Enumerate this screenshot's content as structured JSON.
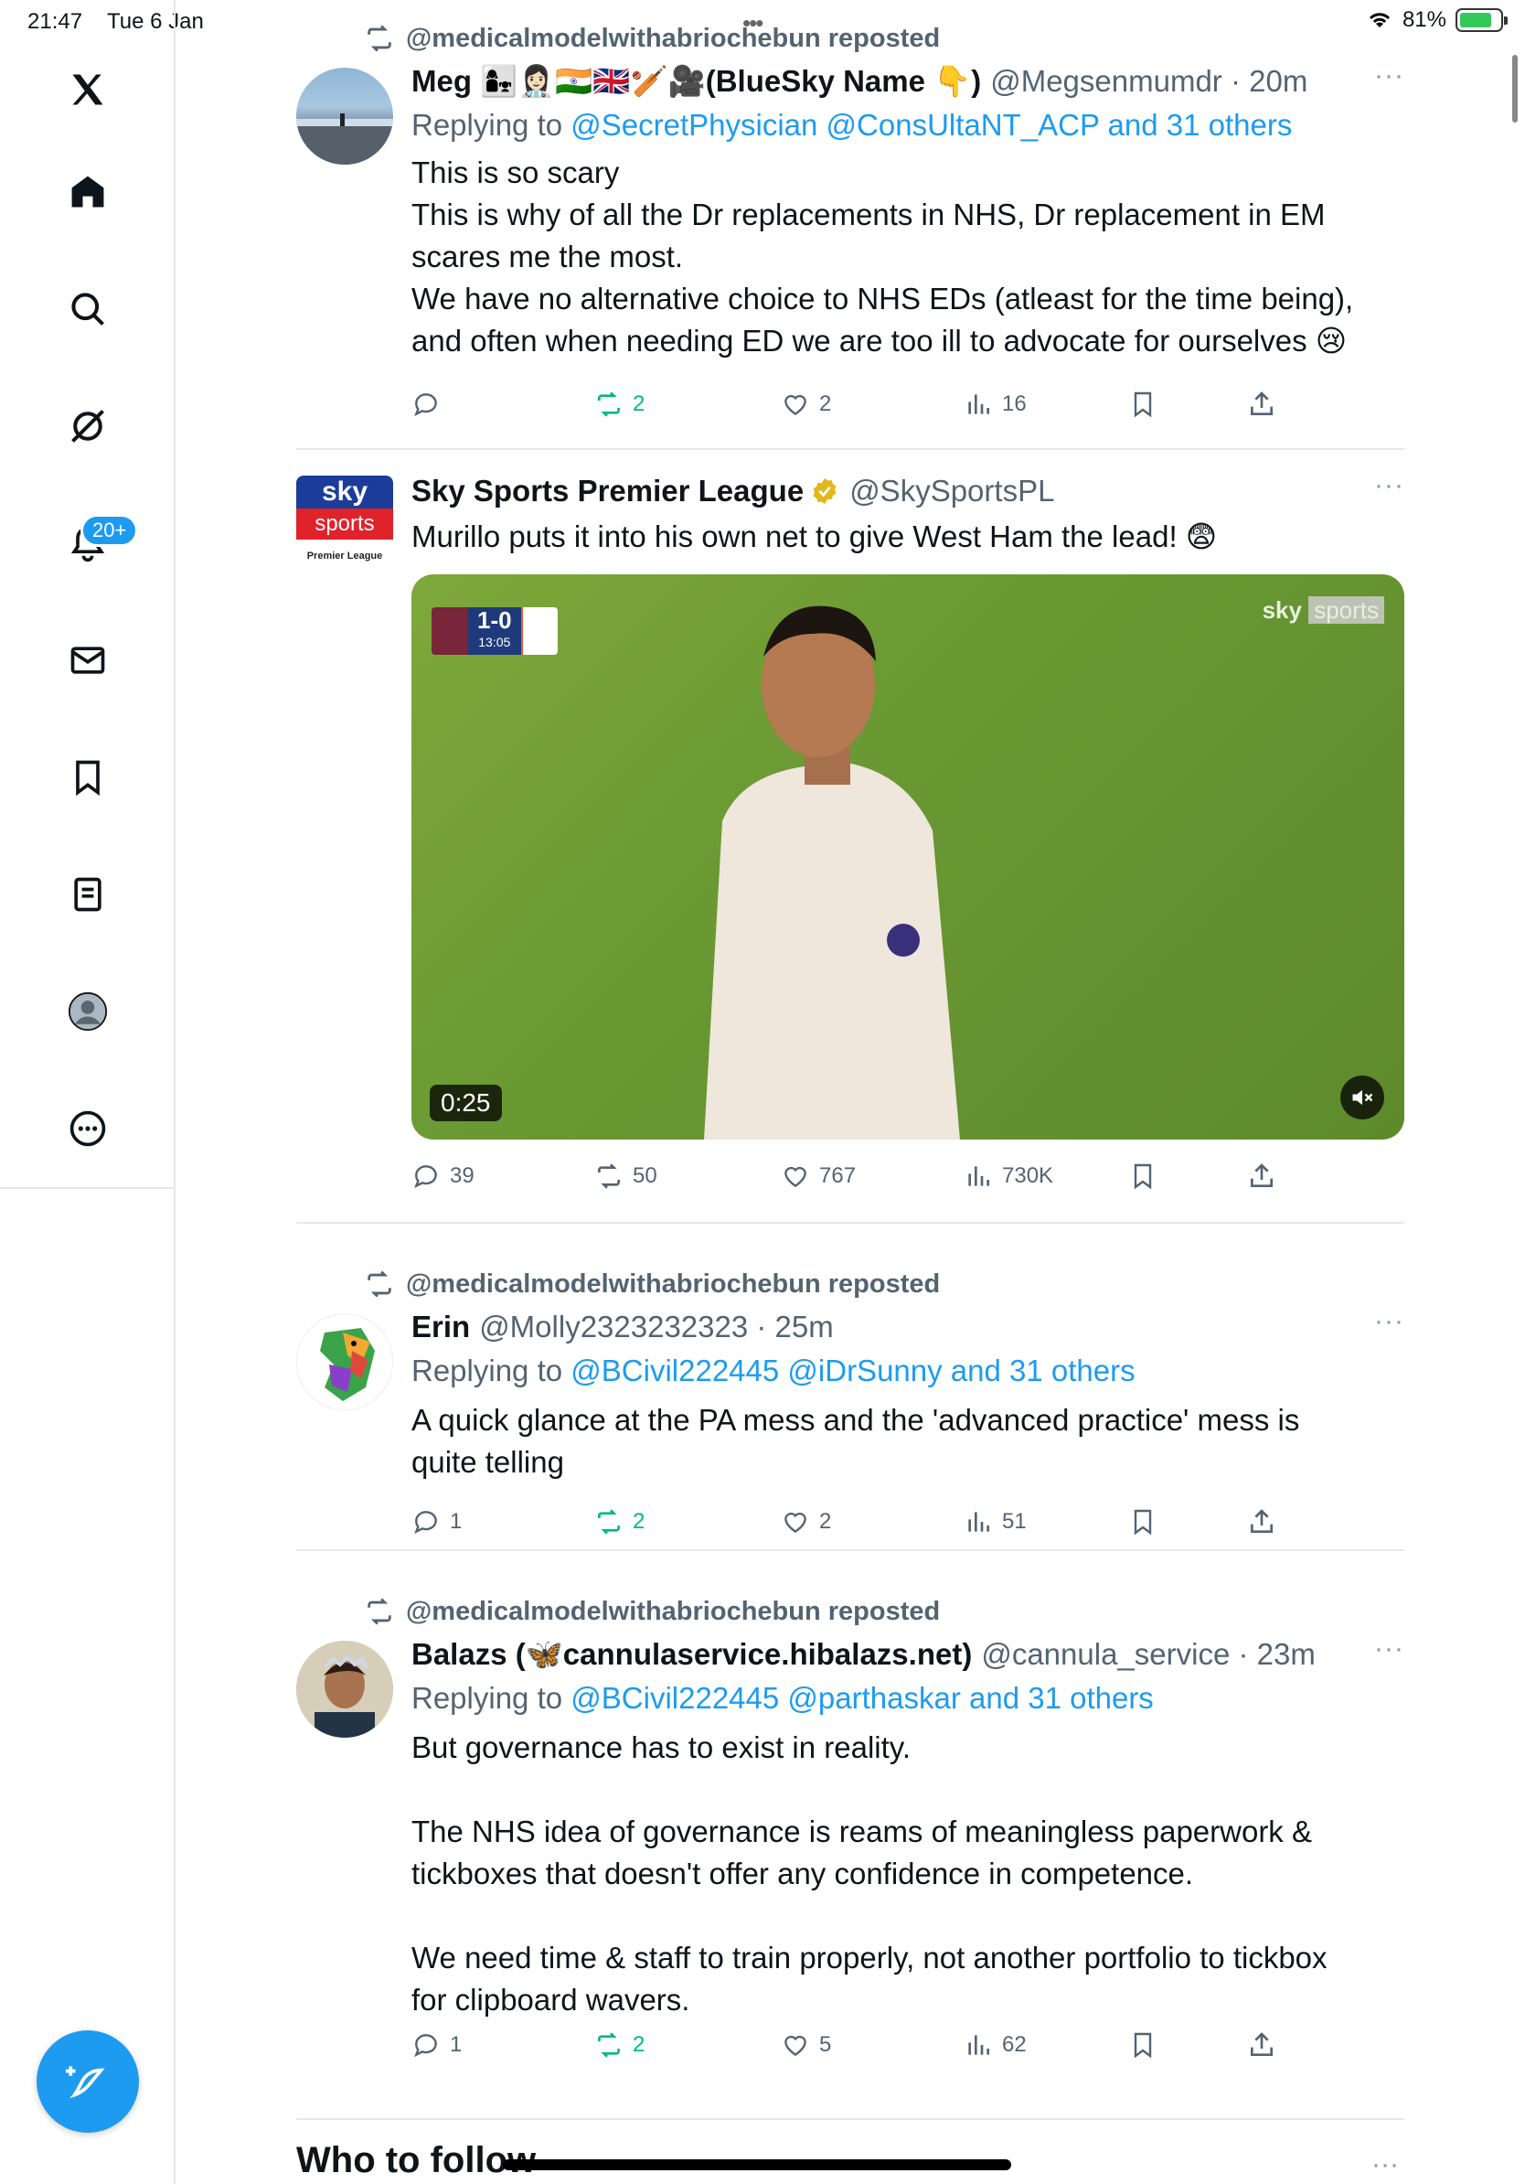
{
  "status_bar": {
    "time": "21:47",
    "date": "Tue 6 Jan",
    "battery": "81%",
    "battery_level": 0.81
  },
  "sidebar": {
    "items": [
      {
        "name": "x-logo-icon"
      },
      {
        "name": "home-icon"
      },
      {
        "name": "search-icon"
      },
      {
        "name": "grok-icon"
      },
      {
        "name": "notifications-icon",
        "badge": "20+"
      },
      {
        "name": "messages-icon"
      },
      {
        "name": "bookmarks-icon"
      },
      {
        "name": "lists-icon"
      },
      {
        "name": "profile-icon"
      },
      {
        "name": "more-icon"
      }
    ],
    "compose": "compose-icon"
  },
  "posts": [
    {
      "repost_by": "@medicalmodelwithabriochebun reposted",
      "name": "Meg 👩‍👧👩🏻‍⚕️🇮🇳🇬🇧🏏🎥(BlueSky Name 👇)",
      "handle": "@Megsenmumdr · 20m",
      "reply_prefix": "Replying to",
      "reply_to": "@SecretPhysician @ConsUltaNT_ACP and 31 others",
      "text": [
        "This is so scary",
        "This is why of all the Dr replacements in NHS, Dr replacement in EM",
        "scares me the most.",
        "We have no alternative choice to NHS EDs (atleast for the time being),",
        "and often when needing ED we are too ill to advocate for ourselves 😢"
      ],
      "replies": "",
      "reposts": "2",
      "likes": "2",
      "views": "16"
    },
    {
      "name": "Sky Sports Premier League",
      "handle": "@SkySportsPL",
      "text": [
        "Murillo puts it into his own net to give West Ham the lead! 😨"
      ],
      "avatar_text": {
        "sky": "sky",
        "sports": "sports",
        "league": "Premier League"
      },
      "media": {
        "duration": "0:25",
        "score": "1-0",
        "clock": "13:05",
        "watermark_a": "sky",
        "watermark_b": "sports"
      },
      "replies": "39",
      "reposts": "50",
      "likes": "767",
      "views": "730K"
    },
    {
      "repost_by": "@medicalmodelwithabriochebun reposted",
      "name": "Erin",
      "handle": "@Molly2323232323 · 25m",
      "reply_prefix": "Replying to",
      "reply_to": "@BCivil222445 @iDrSunny and 31 others",
      "text": [
        "A quick glance at the PA mess and the 'advanced practice' mess is",
        "quite telling"
      ],
      "replies": "1",
      "reposts": "2",
      "likes": "2",
      "views": "51"
    },
    {
      "repost_by": "@medicalmodelwithabriochebun reposted",
      "name": "Balazs (🦋cannulaservice.hibalazs.net)",
      "handle": "@cannula_service · 23m",
      "reply_prefix": "Replying to",
      "reply_to": "@BCivil222445 @parthaskar and 31 others",
      "text": [
        "But governance has to exist in reality.",
        "",
        "The NHS idea of governance is reams of meaningless paperwork &",
        "tickboxes that doesn't offer any confidence in competence.",
        "",
        "We need time & staff to train properly, not another portfolio to tickbox",
        "for clipboard wavers."
      ],
      "replies": "1",
      "reposts": "2",
      "likes": "5",
      "views": "62"
    }
  ],
  "who_to_follow": "Who to follow",
  "more_glyph": "···",
  "colors": {
    "accent": "#1d9bf0",
    "repost": "#00ba7c",
    "muted": "#536471"
  }
}
